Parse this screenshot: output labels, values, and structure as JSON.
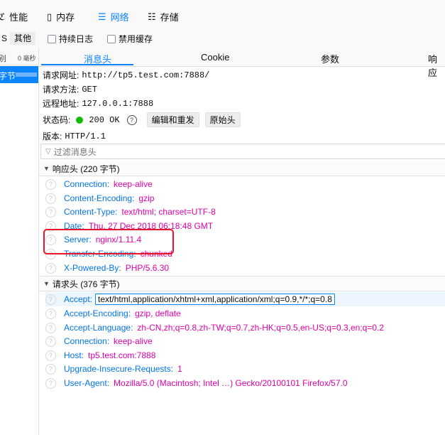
{
  "top_tabs": [
    {
      "label": "性能",
      "icon": "performance-icon",
      "glyph": "ℭ"
    },
    {
      "label": "内存",
      "icon": "memory-icon",
      "glyph": "▯"
    },
    {
      "label": "网络",
      "icon": "network-icon",
      "glyph": "☰"
    },
    {
      "label": "存储",
      "icon": "storage-icon",
      "glyph": "☷"
    }
  ],
  "filter_bar": {
    "type_s": "S",
    "type_other": "其他",
    "persist_logs": "持续日志",
    "disable_cache": "禁用缓存"
  },
  "left_list": {
    "head_col1": "别",
    "head_col2": "0 毫秒",
    "selected_label": "字节"
  },
  "detail_tabs": [
    "消息头",
    "Cookie",
    "参数",
    "响应"
  ],
  "summary": {
    "url_label": "请求网址:",
    "url_value": "http://tp5.test.com:7888/",
    "method_label": "请求方法:",
    "method_value": "GET",
    "remote_label": "远程地址:",
    "remote_value": "127.0.0.1:7888",
    "status_label": "状态码:",
    "status_value": "200 OK",
    "help_glyph": "?",
    "edit_resend": "编辑和重发",
    "raw_headers": "原始头",
    "version_label": "版本:",
    "version_value": "HTTP/1.1"
  },
  "filter_headers_placeholder": "过滤消息头",
  "response_headers": {
    "title": "响应头 (220 字节)",
    "rows": [
      {
        "name": "Connection:",
        "value": "keep-alive"
      },
      {
        "name": "Content-Encoding:",
        "value": "gzip"
      },
      {
        "name": "Content-Type:",
        "value": "text/html; charset=UTF-8"
      },
      {
        "name": "Date:",
        "value": "Thu, 27 Dec 2018 06:18:48 GMT"
      },
      {
        "name": "Server:",
        "value": "nginx/1.11.4"
      },
      {
        "name": "Transfer-Encoding:",
        "value": "chunked"
      },
      {
        "name": "X-Powered-By:",
        "value": "PHP/5.6.30"
      }
    ]
  },
  "request_headers": {
    "title": "请求头 (376 字节)",
    "rows": [
      {
        "name": "Accept:",
        "value": "text/html,application/xhtml+xml,application/xml;q=0.9,*/*;q=0.8"
      },
      {
        "name": "Accept-Encoding:",
        "value": "gzip, deflate"
      },
      {
        "name": "Accept-Language:",
        "value": "zh-CN,zh;q=0.8,zh-TW;q=0.7,zh-HK;q=0.5,en-US;q=0.3,en;q=0.2"
      },
      {
        "name": "Connection:",
        "value": "keep-alive"
      },
      {
        "name": "Host:",
        "value": "tp5.test.com:7888"
      },
      {
        "name": "Upgrade-Insecure-Requests:",
        "value": "1"
      },
      {
        "name": "User-Agent:",
        "value": "Mozilla/5.0 (Macintosh; Intel …) Gecko/20100101 Firefox/57.0"
      }
    ]
  },
  "colors": {
    "accent": "#0a84ff",
    "header_name": "#0074e8",
    "header_value": "#dd00a9",
    "highlight": "#e8152d",
    "status_ok": "#12bc00"
  }
}
